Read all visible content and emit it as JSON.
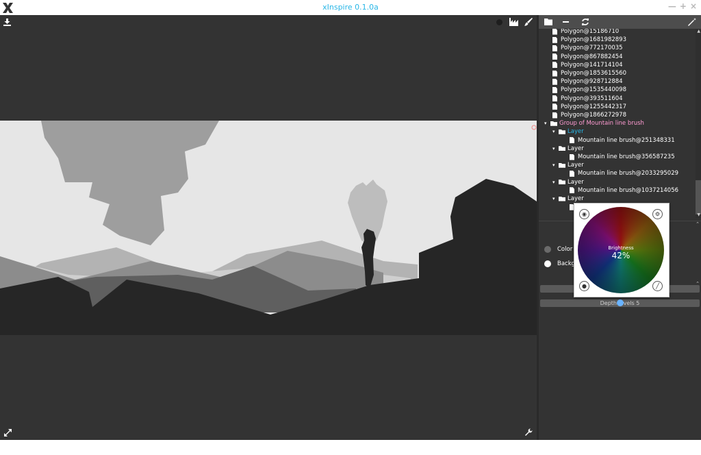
{
  "window": {
    "title": "xInspire 0.1.0a",
    "controls": [
      "—",
      "+",
      "×"
    ]
  },
  "canvas": {
    "top_icons": [
      "download-icon"
    ],
    "right_icons": [
      "circle-icon",
      "chart-icon",
      "brush-icon"
    ],
    "bottom_icons": [
      "expand-icon",
      "wrench-icon"
    ]
  },
  "sidebar": {
    "toolbar_icons": [
      "folder-icon",
      "minus-icon",
      "refresh-icon",
      "magic-wand-icon"
    ],
    "tree": [
      {
        "label": "Polygon@15186710",
        "type": "file",
        "level": 1
      },
      {
        "label": "Polygon@1681982893",
        "type": "file",
        "level": 1
      },
      {
        "label": "Polygon@772170035",
        "type": "file",
        "level": 1
      },
      {
        "label": "Polygon@867882454",
        "type": "file",
        "level": 1
      },
      {
        "label": "Polygon@141714104",
        "type": "file",
        "level": 1
      },
      {
        "label": "Polygon@1853615560",
        "type": "file",
        "level": 1
      },
      {
        "label": "Polygon@928712884",
        "type": "file",
        "level": 1
      },
      {
        "label": "Polygon@1535440098",
        "type": "file",
        "level": 1
      },
      {
        "label": "Polygon@393511604",
        "type": "file",
        "level": 1
      },
      {
        "label": "Polygon@1255442317",
        "type": "file",
        "level": 1
      },
      {
        "label": "Polygon@1866272978",
        "type": "file",
        "level": 1
      },
      {
        "label": "Group of Mountain line brush",
        "type": "folder",
        "level": 0,
        "highlight": true
      },
      {
        "label": "Layer",
        "type": "folder",
        "level": 1,
        "selected": true
      },
      {
        "label": "Mountain line brush@251348331",
        "type": "file",
        "level": 2
      },
      {
        "label": "Layer",
        "type": "folder",
        "level": 1
      },
      {
        "label": "Mountain line brush@356587235",
        "type": "file",
        "level": 2
      },
      {
        "label": "Layer",
        "type": "folder",
        "level": 1
      },
      {
        "label": "Mountain line brush@2033295029",
        "type": "file",
        "level": 2
      },
      {
        "label": "Layer",
        "type": "folder",
        "level": 1
      },
      {
        "label": "Mountain line brush@1037214056",
        "type": "file",
        "level": 2
      },
      {
        "label": "Layer",
        "type": "folder",
        "level": 1
      },
      {
        "label": "",
        "type": "file",
        "level": 2
      }
    ],
    "properties": {
      "color_label": "Color",
      "color_swatch": "#6b6b6b",
      "background_label": "Backg",
      "background_swatch": "#ffffff",
      "depth_label": "Depth levels 5",
      "depth_fraction": 0.5
    }
  },
  "color_picker": {
    "brightness_label": "Brightness",
    "brightness_value": "42%",
    "brightness_fraction": 0.42,
    "corner_icons": [
      "eye-icon",
      "settings-ring-icon",
      "droplet-icon",
      "brush-icon"
    ]
  },
  "colors": {
    "accent": "#29b6e6",
    "highlight": "#ff9bd2",
    "selected": "#29b6e6",
    "sky": "#e6e6e6",
    "panel": "#333333"
  }
}
